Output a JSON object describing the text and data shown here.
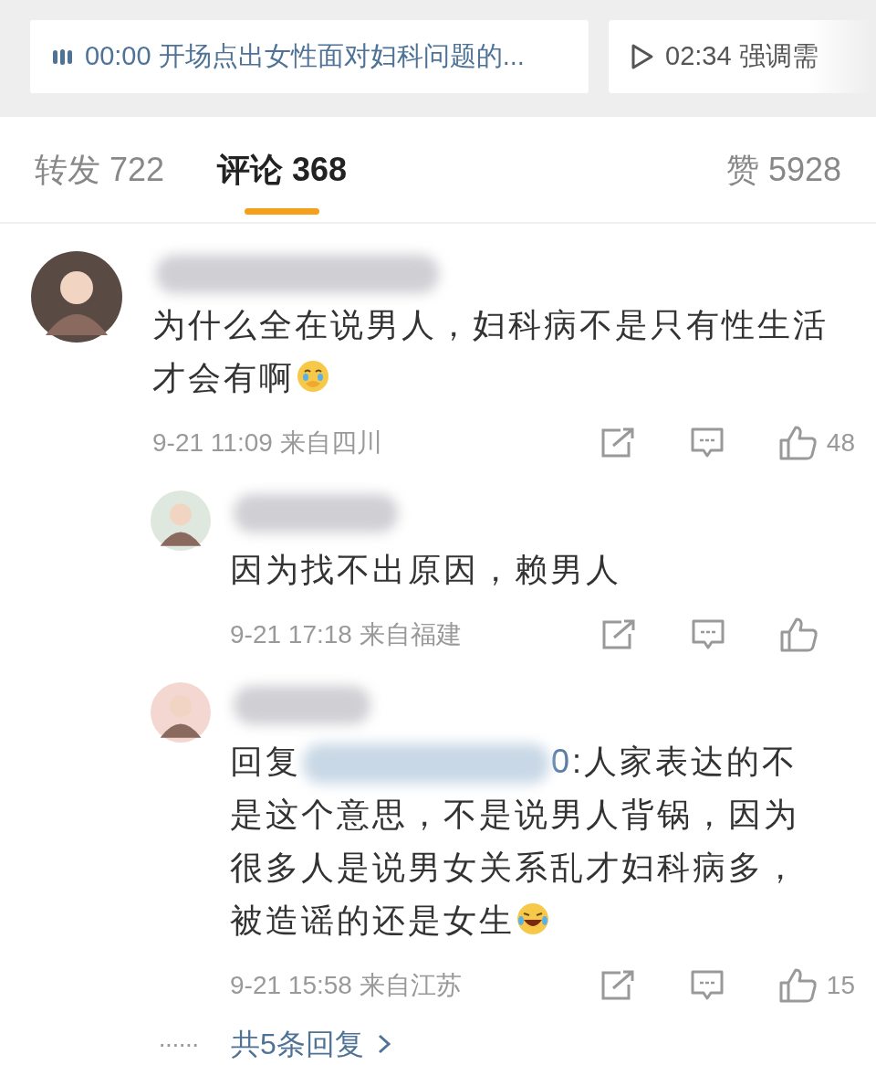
{
  "chapters": [
    {
      "time": "00:00",
      "title": "开场点出女性面对妇科问题的...",
      "playing": true
    },
    {
      "time": "02:34",
      "title": "强调需",
      "playing": false
    }
  ],
  "tabs": [
    {
      "label": "转发 722",
      "selected": false
    },
    {
      "label": "评论 368",
      "selected": true
    },
    {
      "label": "赞 5928",
      "selected": false
    }
  ],
  "comment": {
    "text": "为什么全在说男人，妇科病不是只有性生活才会有啊",
    "kind": "crying-emoji",
    "time": "9-21 11:09",
    "location": "来自四川",
    "likes": "48",
    "replies": [
      {
        "kind": "plain",
        "text": "因为找不出原因，赖男人",
        "time": "9-21 17:18",
        "location": "来自福建"
      },
      {
        "prefix": "回复",
        "mention": "0",
        "text": ":人家表达的不是这个意思，不是说男人背锅，因为很多人是说男女关系乱才妇科病多，被造谣的还是女生",
        "kind": "laughing-emoji",
        "time": "9-21 15:58",
        "location": "来自江苏",
        "likes": "15"
      }
    ],
    "more_replies": {
      "dots": "······",
      "label": "共5条回复"
    }
  }
}
